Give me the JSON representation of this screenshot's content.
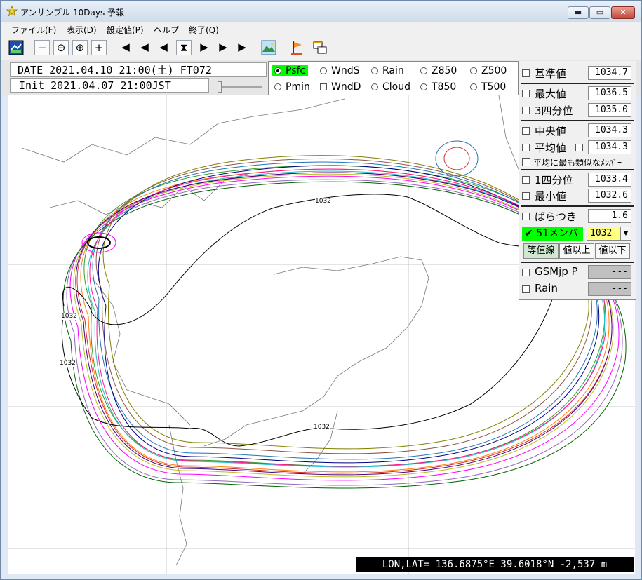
{
  "window": {
    "title": "アンサンブル 10Days 予報",
    "controls": {
      "minimize": "▬",
      "maximize": "▭",
      "close": "✕"
    }
  },
  "menu": [
    "ファイル(F)",
    "表示(D)",
    "設定値(P)",
    "ヘルプ",
    "終了(Q)"
  ],
  "toolbar": {
    "buttons": [
      "map-icon",
      "zoom-out-small-icon",
      "zoom-out-icon",
      "zoom-in-icon",
      "zoom-in-small-icon",
      "first-icon",
      "prev-fast-icon",
      "prev-icon",
      "hourglass-icon",
      "next-icon",
      "next-fast-icon",
      "last-icon",
      "landscape-icon",
      "flag-icon",
      "windows-icon"
    ],
    "glyphs": {
      "zoom_out_small": "−",
      "zoom_out": "⊖",
      "zoom_in": "⊕",
      "zoom_in_small": "+",
      "first": "◀",
      "prev_fast": "◀",
      "prev": "◀",
      "hourglass": "⧗",
      "next": "▶",
      "next_fast": "▶",
      "last": "▶"
    }
  },
  "info": {
    "date": "DATE 2021.04.10 21:00(土) FT072",
    "init": "Init 2021.04.07 21:00JST"
  },
  "variables": {
    "row1": [
      {
        "label": "Psfc",
        "kind": "radio",
        "selected": true
      },
      {
        "label": "WndS",
        "kind": "radio",
        "selected": false
      },
      {
        "label": "Rain",
        "kind": "radio",
        "selected": false
      },
      {
        "label": "Z850",
        "kind": "radio",
        "selected": false
      },
      {
        "label": "Z500",
        "kind": "radio",
        "selected": false
      }
    ],
    "row2": [
      {
        "label": "Pmin",
        "kind": "radio",
        "selected": false
      },
      {
        "label": "WndD",
        "kind": "check",
        "selected": false
      },
      {
        "label": "Cloud",
        "kind": "radio",
        "selected": false
      },
      {
        "label": "T850",
        "kind": "radio",
        "selected": false
      },
      {
        "label": "T500",
        "kind": "radio",
        "selected": false
      }
    ]
  },
  "stats": {
    "base": {
      "label": "基準値",
      "value": "1034.7"
    },
    "max": {
      "label": "最大値",
      "value": "1036.5"
    },
    "q3": {
      "label": "3四分位",
      "value": "1035.0"
    },
    "median": {
      "label": "中央値",
      "value": "1034.3"
    },
    "mean": {
      "label": "平均値",
      "value": "1034.3"
    },
    "similar": {
      "label": "平均に最も類似なﾒﾝﾊﾞｰ"
    },
    "q1": {
      "label": "1四分位",
      "value": "1033.4"
    },
    "min": {
      "label": "最小値",
      "value": "1032.6"
    },
    "spread": {
      "label": "ばらつき",
      "value": "1.6"
    },
    "members": {
      "label": "51メンバー",
      "value": "1032",
      "checked": true,
      "dropdown": "▼"
    },
    "buttons": [
      "等值線",
      "値以上",
      "値以下"
    ],
    "gsm": {
      "label": "GSMjp P",
      "value": "---"
    },
    "rain": {
      "label": "Rain",
      "value": "---"
    }
  },
  "map": {
    "contour_labels": [
      "1032",
      "1032",
      "1032",
      "1032"
    ]
  },
  "status": {
    "text": "LON,LAT= 136.6875°E  39.6018°N  -2,537 m"
  }
}
